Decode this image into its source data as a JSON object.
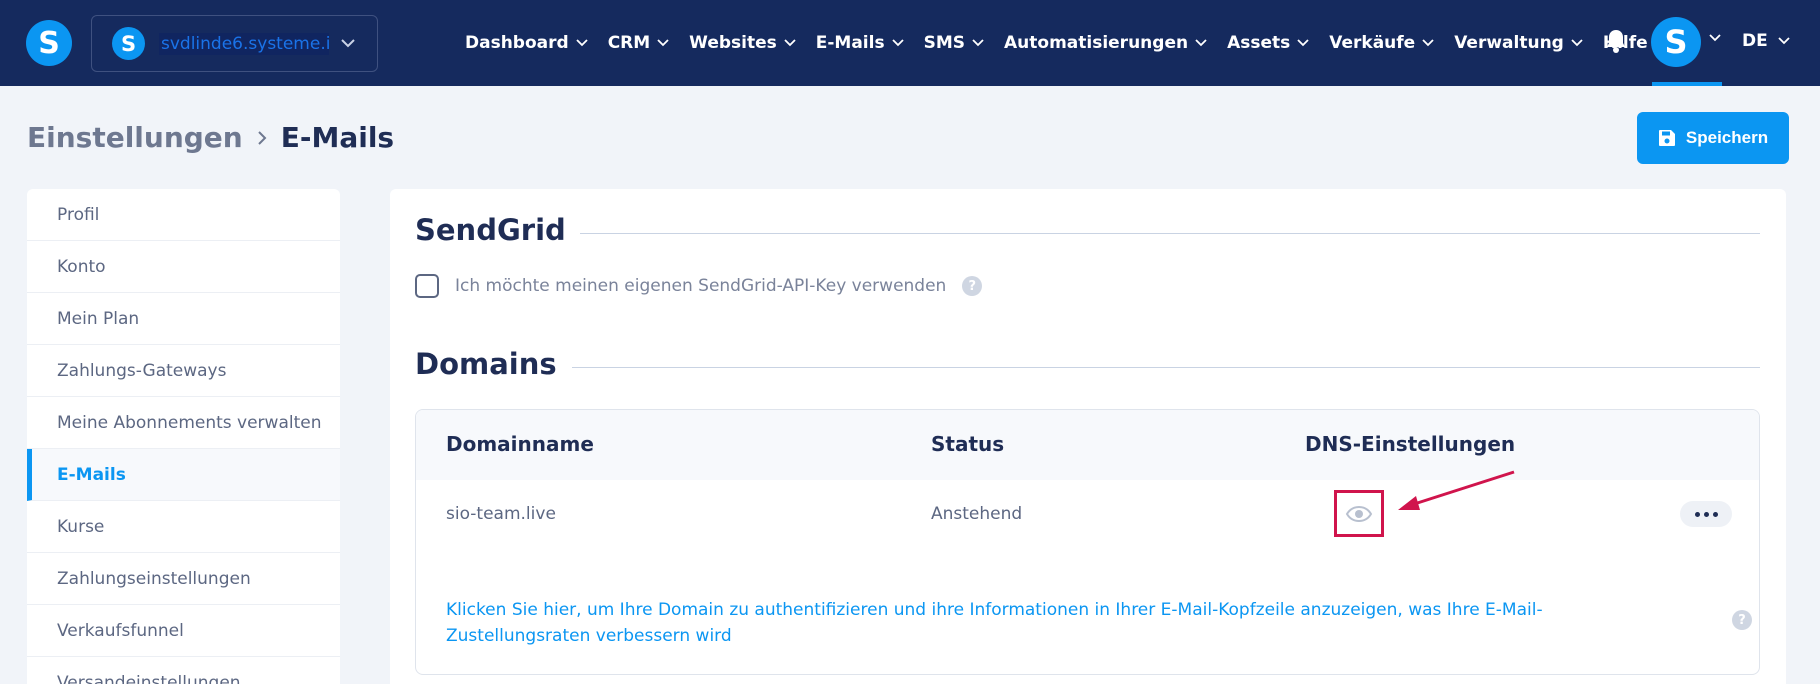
{
  "topbar": {
    "logo_letter": "S",
    "workspace": {
      "logo_letter": "S",
      "name": "svdlinde6.systeme.io"
    },
    "nav": [
      {
        "label": "Dashboard",
        "has_dropdown": true
      },
      {
        "label": "CRM",
        "has_dropdown": true
      },
      {
        "label": "Websites",
        "has_dropdown": true
      },
      {
        "label": "E-Mails",
        "has_dropdown": true
      },
      {
        "label": "SMS",
        "has_dropdown": true
      },
      {
        "label": "Automatisierungen",
        "has_dropdown": true
      },
      {
        "label": "Assets",
        "has_dropdown": true
      },
      {
        "label": "Verkäufe",
        "has_dropdown": true
      },
      {
        "label": "Verwaltung",
        "has_dropdown": true
      },
      {
        "label": "Hilfe",
        "has_dropdown": false
      }
    ],
    "avatar_letter": "S",
    "language": "DE"
  },
  "header": {
    "breadcrumb_root": "Einstellungen",
    "breadcrumb_current": "E-Mails",
    "save_label": "Speichern"
  },
  "sidebar": {
    "items": [
      {
        "label": "Profil",
        "active": false
      },
      {
        "label": "Konto",
        "active": false
      },
      {
        "label": "Mein Plan",
        "active": false
      },
      {
        "label": "Zahlungs-Gateways",
        "active": false
      },
      {
        "label": "Meine Abonnements verwalten",
        "active": false
      },
      {
        "label": "E-Mails",
        "active": true
      },
      {
        "label": "Kurse",
        "active": false
      },
      {
        "label": "Zahlungseinstellungen",
        "active": false
      },
      {
        "label": "Verkaufsfunnel",
        "active": false
      },
      {
        "label": "Versandeinstellungen",
        "active": false
      }
    ]
  },
  "sendgrid": {
    "title": "SendGrid",
    "checkbox_label": "Ich möchte meinen eigenen SendGrid-API-Key verwenden",
    "checked": false
  },
  "domains": {
    "title": "Domains",
    "columns": [
      "Domainname",
      "Status",
      "DNS-Einstellungen"
    ],
    "rows": [
      {
        "domain": "sio-team.live",
        "status": "Anstehend"
      }
    ],
    "info_text": "Klicken Sie hier, um Ihre Domain zu authentifizieren und ihre Informationen in Ihrer E-Mail-Kopfzeile anzuzeigen, was Ihre E-Mail-Zustellungsraten verbessern wird"
  },
  "icons": {
    "chevron": "chevron-down-icon",
    "bell": "bell-icon",
    "save": "floppy-disk-icon",
    "eye": "eye-icon",
    "more": "more-horizontal-icon",
    "help": "question-circle-icon",
    "annotation": "red-arrow-annotation"
  },
  "colors": {
    "nav_bg": "#152a5e",
    "accent": "#0b96f2",
    "annotation_red": "#d0144c",
    "page_bg": "#f1f4f9"
  }
}
